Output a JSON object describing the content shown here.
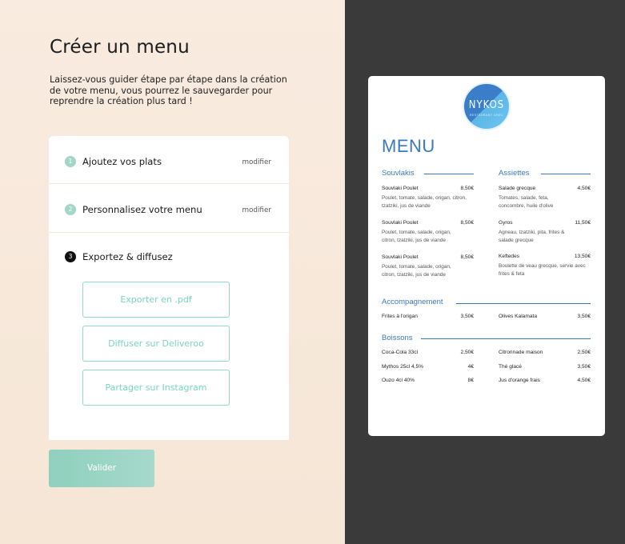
{
  "page": {
    "title": "Créer un menu",
    "intro": "Laissez-vous guider étape par étape dans la création de votre menu, vous pourrez le sauvegarder pour reprendre la création plus tard !"
  },
  "steps": [
    {
      "number": "1",
      "label": "Ajoutez vos plats",
      "action": "modifier"
    },
    {
      "number": "2",
      "label": "Personnalisez votre menu",
      "action": "modifier"
    },
    {
      "number": "3",
      "label": "Exportez & diffusez"
    }
  ],
  "export_buttons": [
    "Exporter en .pdf",
    "Diffuser sur Deliveroo",
    "Partager sur Instagram"
  ],
  "validate_label": "Valider",
  "menu_preview": {
    "logo": "NYKOS",
    "logo_sub": "RESTAURANT GREC",
    "title": "MENU",
    "sections": {
      "souvlakis": {
        "title": "Souvlakis",
        "items": [
          {
            "name": "Souvlaki Poulet",
            "price": "8,50€",
            "desc": "Poulet, tomate, salade, origan, citron, tzatziki, jus de viande"
          },
          {
            "name": "Souvlaki Poulet",
            "price": "8,50€",
            "desc": "Poulet, tomate, salade, origan, citron, tzatziki, jus de viande"
          },
          {
            "name": "Souvlaki Poulet",
            "price": "8,50€",
            "desc": "Poulet, tomate, salade, origan, citron, tzatziki, jus de viande"
          }
        ]
      },
      "assiettes": {
        "title": "Assiettes",
        "items": [
          {
            "name": "Salade grecque",
            "price": "4,50€",
            "desc": "Tomates, salade, feta, concombre, huile d'olive"
          },
          {
            "name": "Gyros",
            "price": "11,50€",
            "desc": "Agneau, tzatziki, pita, frites & salade grecque"
          },
          {
            "name": "Keftedes",
            "price": "13,50€",
            "desc": "Boulette de veau grecque, servie avec frites & feta"
          }
        ]
      },
      "accompagnement": {
        "title": "Accompagnement",
        "items": [
          {
            "name": "Frites à l'origan",
            "price": "3,50€"
          },
          {
            "name": "Olives Kalamata",
            "price": "3,50€"
          }
        ]
      },
      "boissons": {
        "title": "Boissons",
        "left": [
          {
            "name": "Coca-Cola 33cl",
            "price": "2,50€"
          },
          {
            "name": "Mythos 25cl 4,5%",
            "price": "4€"
          },
          {
            "name": "Ouzo 4cl 40%",
            "price": "8€"
          }
        ],
        "right": [
          {
            "name": "Citronnade maison",
            "price": "2,50€"
          },
          {
            "name": "Thé glacé",
            "price": "3,50€"
          },
          {
            "name": "Jus d'orange frais",
            "price": "4,50€"
          }
        ]
      }
    }
  },
  "colors": {
    "accent_mint": "#8fd0bd",
    "menu_blue": "#3a79bf",
    "left_bg": "#f9ebdf",
    "right_bg": "#3a3a3a"
  }
}
